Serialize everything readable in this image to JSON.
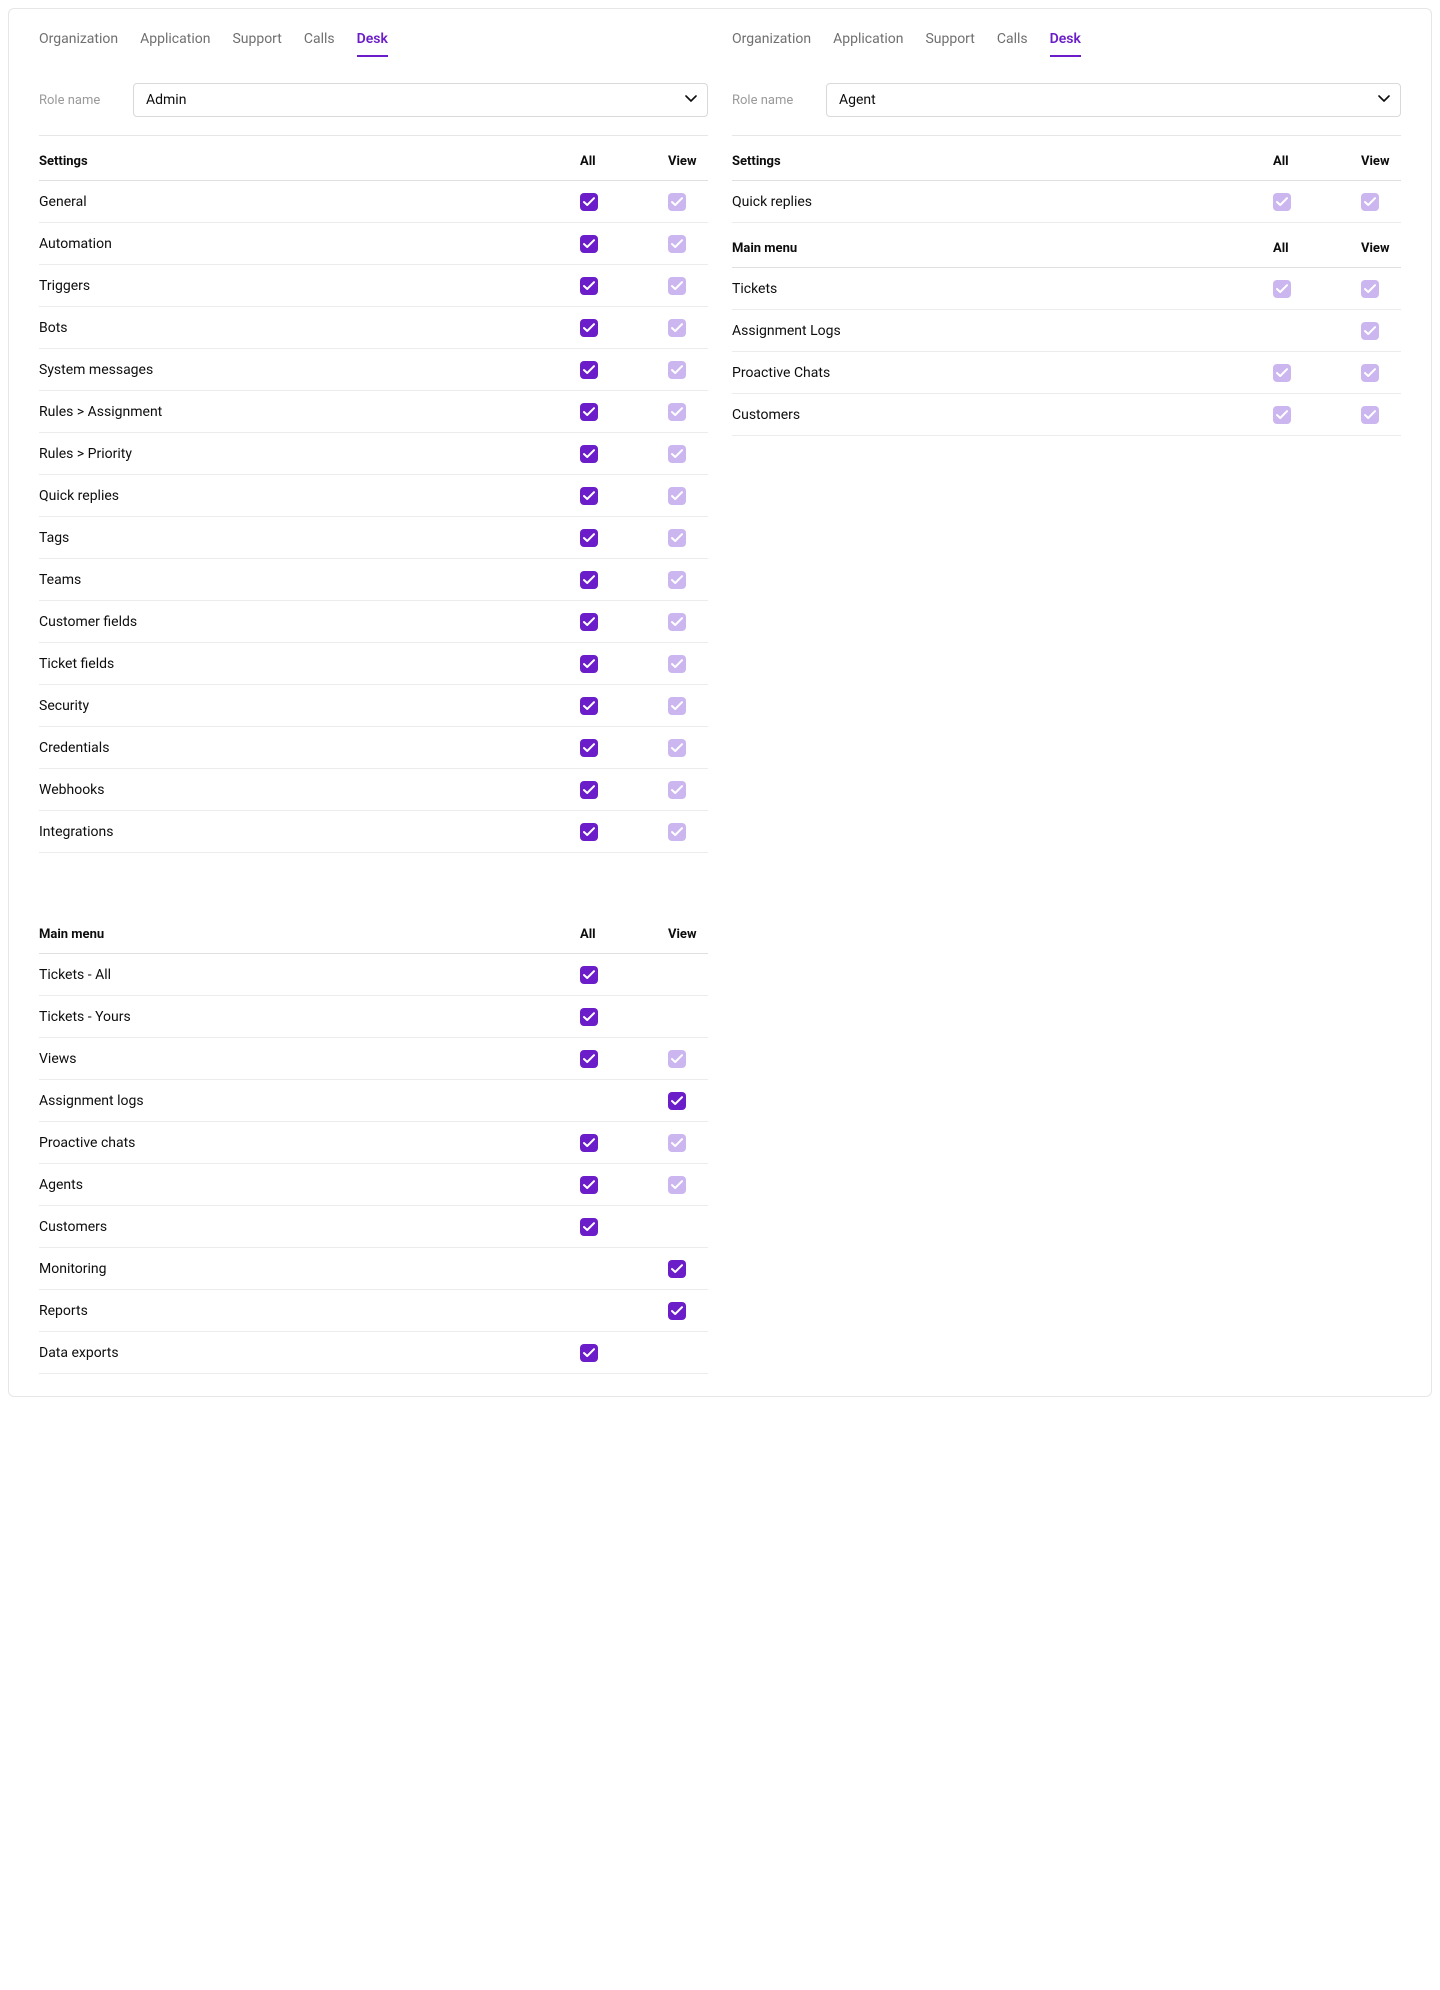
{
  "tabs": [
    "Organization",
    "Application",
    "Support",
    "Calls",
    "Desk"
  ],
  "active_tab": "Desk",
  "role_label": "Role name",
  "left": {
    "role_value": "Admin",
    "sections": [
      {
        "title": "Settings",
        "col_all": "All",
        "col_view": "View",
        "rows": [
          {
            "label": "General",
            "all": "on",
            "view": "dim"
          },
          {
            "label": "Automation",
            "all": "on",
            "view": "dim"
          },
          {
            "label": "Triggers",
            "all": "on",
            "view": "dim"
          },
          {
            "label": "Bots",
            "all": "on",
            "view": "dim"
          },
          {
            "label": "System messages",
            "all": "on",
            "view": "dim"
          },
          {
            "label": "Rules > Assignment",
            "all": "on",
            "view": "dim"
          },
          {
            "label": "Rules > Priority",
            "all": "on",
            "view": "dim"
          },
          {
            "label": "Quick replies",
            "all": "on",
            "view": "dim"
          },
          {
            "label": "Tags",
            "all": "on",
            "view": "dim"
          },
          {
            "label": "Teams",
            "all": "on",
            "view": "dim"
          },
          {
            "label": "Customer fields",
            "all": "on",
            "view": "dim"
          },
          {
            "label": "Ticket fields",
            "all": "on",
            "view": "dim"
          },
          {
            "label": "Security",
            "all": "on",
            "view": "dim"
          },
          {
            "label": "Credentials",
            "all": "on",
            "view": "dim"
          },
          {
            "label": "Webhooks",
            "all": "on",
            "view": "dim"
          },
          {
            "label": "Integrations",
            "all": "on",
            "view": "dim"
          }
        ]
      },
      {
        "title": "Main menu",
        "col_all": "All",
        "col_view": "View",
        "rows": [
          {
            "label": "Tickets - All",
            "all": "on",
            "view": "empty"
          },
          {
            "label": "Tickets - Yours",
            "all": "on",
            "view": "empty"
          },
          {
            "label": "Views",
            "all": "on",
            "view": "dim"
          },
          {
            "label": "Assignment logs",
            "all": "empty",
            "view": "on"
          },
          {
            "label": "Proactive chats",
            "all": "on",
            "view": "dim"
          },
          {
            "label": "Agents",
            "all": "on",
            "view": "dim"
          },
          {
            "label": "Customers",
            "all": "on",
            "view": "empty"
          },
          {
            "label": "Monitoring",
            "all": "empty",
            "view": "on"
          },
          {
            "label": "Reports",
            "all": "empty",
            "view": "on"
          },
          {
            "label": "Data exports",
            "all": "on",
            "view": "empty"
          }
        ]
      }
    ]
  },
  "right": {
    "role_value": "Agent",
    "sections": [
      {
        "title": "Settings",
        "col_all": "All",
        "col_view": "View",
        "rows": [
          {
            "label": "Quick replies",
            "all": "dim",
            "view": "dim"
          }
        ]
      },
      {
        "title": "Main menu",
        "col_all": "All",
        "col_view": "View",
        "rows": [
          {
            "label": "Tickets",
            "all": "dim",
            "view": "dim"
          },
          {
            "label": "Assignment Logs",
            "all": "empty",
            "view": "dim"
          },
          {
            "label": "Proactive Chats",
            "all": "dim",
            "view": "dim"
          },
          {
            "label": "Customers",
            "all": "dim",
            "view": "dim"
          }
        ]
      }
    ]
  }
}
